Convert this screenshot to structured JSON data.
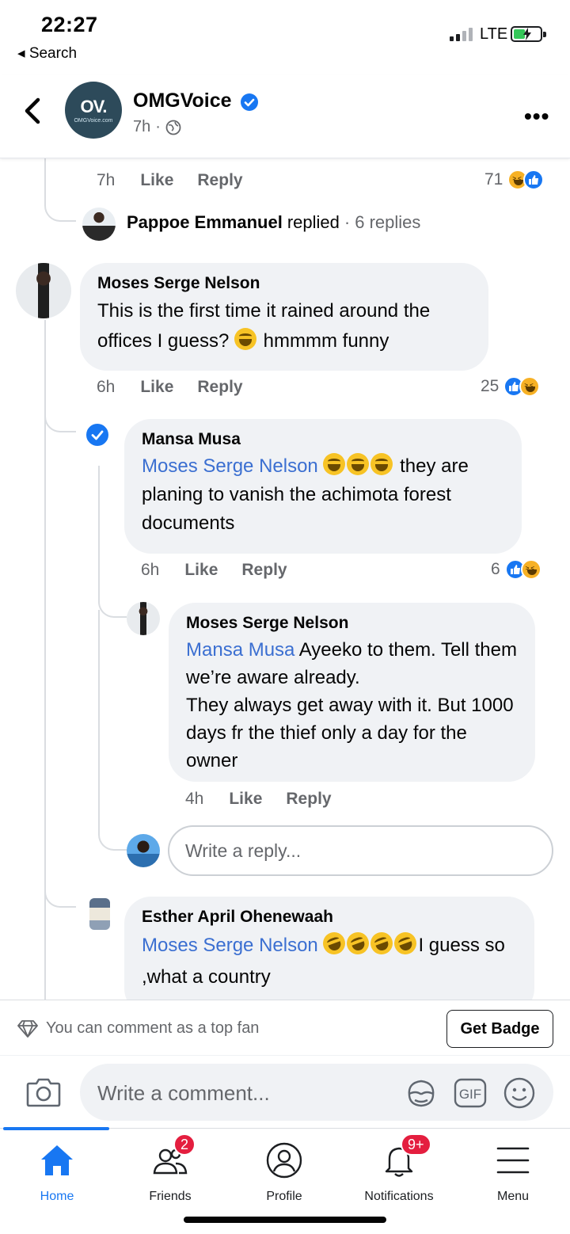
{
  "status_bar": {
    "time": "22:27",
    "back_label": "◂ Search",
    "network": "LTE"
  },
  "header": {
    "page_name": "OMGVoice",
    "time": "7h",
    "separator": "·",
    "logo_text": "OV.",
    "logo_sub": "OMGVoice.com"
  },
  "thread": {
    "top_meta": {
      "time": "7h",
      "like": "Like",
      "reply": "Reply",
      "reaction_count": "71"
    },
    "replies_summary": {
      "name": "Pappoe Emmanuel",
      "action": "replied",
      "separator": "·",
      "count": "6 replies"
    },
    "comments": [
      {
        "author": "Moses Serge Nelson",
        "text_1": "This is the first time it rained around the offices I guess?",
        "text_2": "hmmmm funny",
        "time": "6h",
        "like": "Like",
        "reply": "Reply",
        "reaction_count": "25"
      },
      {
        "author": "Mansa Musa",
        "mention": "Moses Serge Nelson",
        "text_1": "they are",
        "text_2": "planing to vanish the achimota forest documents",
        "time": "6h",
        "like": "Like",
        "reply": "Reply",
        "reaction_count": "6"
      },
      {
        "author": "Moses Serge Nelson",
        "mention": "Mansa Musa",
        "text_1": "Ayeeko to them. Tell them we’re aware already.",
        "text_2": "They always get away with it. But 1000 days fr the thief only a day for the owner",
        "time": "4h",
        "like": "Like",
        "reply": "Reply"
      },
      {
        "author": "Esther April Ohenewaah",
        "mention": "Moses Serge Nelson",
        "text_1": "I guess so ,what a country"
      }
    ],
    "reply_placeholder": "Write a reply..."
  },
  "top_fan": {
    "message": "You can comment as a top fan",
    "button": "Get Badge"
  },
  "composer": {
    "placeholder": "Write a comment..."
  },
  "tabs": [
    {
      "label": "Home",
      "icon": "home-icon",
      "active": true
    },
    {
      "label": "Friends",
      "icon": "friends-icon",
      "badge": "2"
    },
    {
      "label": "Profile",
      "icon": "profile-icon"
    },
    {
      "label": "Notifications",
      "icon": "bell-icon",
      "badge": "9+"
    },
    {
      "label": "Menu",
      "icon": "menu-icon"
    }
  ],
  "colors": {
    "accent": "#1877f2",
    "mention": "#3b6fd1",
    "badge": "#e41e3f",
    "bubble": "#f0f2f5"
  }
}
